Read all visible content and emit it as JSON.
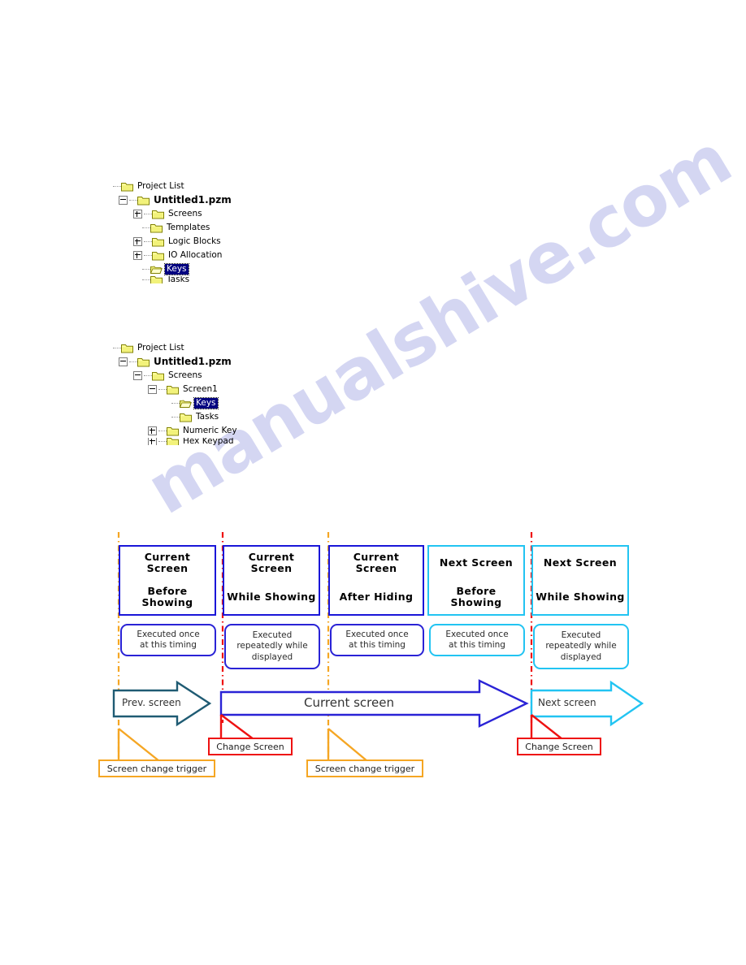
{
  "watermark": {
    "text": "manualshive.com"
  },
  "tree_top": {
    "name": "project-list-tree-collapsed",
    "nodes": [
      {
        "label": "Project List",
        "indent": 0,
        "expander": "none",
        "folder": "closed",
        "bold": false,
        "selected": false
      },
      {
        "label": "Untitled1.pzm",
        "indent": 1,
        "expander": "minus",
        "folder": "closed",
        "bold": true,
        "selected": false
      },
      {
        "label": "Screens",
        "indent": 2,
        "expander": "plus",
        "folder": "closed",
        "bold": false,
        "selected": false
      },
      {
        "label": "Templates",
        "indent": 2,
        "expander": "none",
        "folder": "closed",
        "bold": false,
        "selected": false
      },
      {
        "label": "Logic Blocks",
        "indent": 2,
        "expander": "plus",
        "folder": "closed",
        "bold": false,
        "selected": false
      },
      {
        "label": "IO Allocation",
        "indent": 2,
        "expander": "plus",
        "folder": "closed",
        "bold": false,
        "selected": false
      },
      {
        "label": "Keys",
        "indent": 2,
        "expander": "none",
        "folder": "open",
        "bold": false,
        "selected": true
      },
      {
        "label": "Tasks",
        "indent": 2,
        "expander": "none",
        "folder": "closed",
        "bold": false,
        "selected": false
      }
    ]
  },
  "tree_bottom": {
    "name": "project-list-tree-expanded",
    "nodes": [
      {
        "label": "Project List",
        "indent": 0,
        "expander": "none",
        "folder": "closed",
        "bold": false,
        "selected": false
      },
      {
        "label": "Untitled1.pzm",
        "indent": 1,
        "expander": "minus",
        "folder": "closed",
        "bold": true,
        "selected": false
      },
      {
        "label": "Screens",
        "indent": 2,
        "expander": "minus",
        "folder": "closed",
        "bold": false,
        "selected": false
      },
      {
        "label": "Screen1",
        "indent": 3,
        "expander": "minus",
        "folder": "closed",
        "bold": false,
        "selected": false
      },
      {
        "label": "Keys",
        "indent": 4,
        "expander": "none",
        "folder": "open",
        "bold": false,
        "selected": true
      },
      {
        "label": "Tasks",
        "indent": 4,
        "expander": "none",
        "folder": "closed",
        "bold": false,
        "selected": false
      },
      {
        "label": "Numeric Key",
        "indent": 3,
        "expander": "plus",
        "folder": "closed",
        "bold": false,
        "selected": false
      },
      {
        "label": "Hex Keypad",
        "indent": 3,
        "expander": "plus",
        "folder": "closed",
        "bold": false,
        "selected": false
      }
    ]
  },
  "diagram": {
    "colors": {
      "blue": "#1a16d8",
      "cyan": "#22c4f2",
      "orange": "#f5a623",
      "red": "#ee1111",
      "teal_arrow": "#1f5b73"
    },
    "columns": [
      {
        "screen": "Current\nScreen",
        "screen_line1": "Current",
        "screen_line2": "Screen",
        "timing_line1": "Before",
        "timing_line2": "Showing",
        "note_line1": "Executed once",
        "note_line2": "at this timing",
        "note_line3": "",
        "color": "blue"
      },
      {
        "screen_line1": "Current",
        "screen_line2": "Screen",
        "timing_line1": "While Showing",
        "timing_line2": "",
        "note_line1": "Executed",
        "note_line2": "repeatedly while",
        "note_line3": "displayed",
        "color": "blue"
      },
      {
        "screen_line1": "Current",
        "screen_line2": "Screen",
        "timing_line1": "After Hiding",
        "timing_line2": "",
        "note_line1": "Executed once",
        "note_line2": "at this timing",
        "note_line3": "",
        "color": "blue"
      },
      {
        "screen_line1": "Next Screen",
        "screen_line2": "",
        "timing_line1": "Before",
        "timing_line2": "Showing",
        "note_line1": "Executed once",
        "note_line2": "at this timing",
        "note_line3": "",
        "color": "cyan"
      },
      {
        "screen_line1": "Next Screen",
        "screen_line2": "",
        "timing_line1": "While Showing",
        "timing_line2": "",
        "note_line1": "Executed",
        "note_line2": "repeatedly while",
        "note_line3": "displayed",
        "color": "cyan"
      }
    ],
    "timeline": {
      "prev_label": "Prev. screen",
      "current_label": "Current screen",
      "next_label": "Next screen"
    },
    "callouts": {
      "trigger_left": "Screen change trigger",
      "trigger_right": "Screen change trigger",
      "change_left": "Change Screen",
      "change_right": "Change Screen"
    }
  }
}
